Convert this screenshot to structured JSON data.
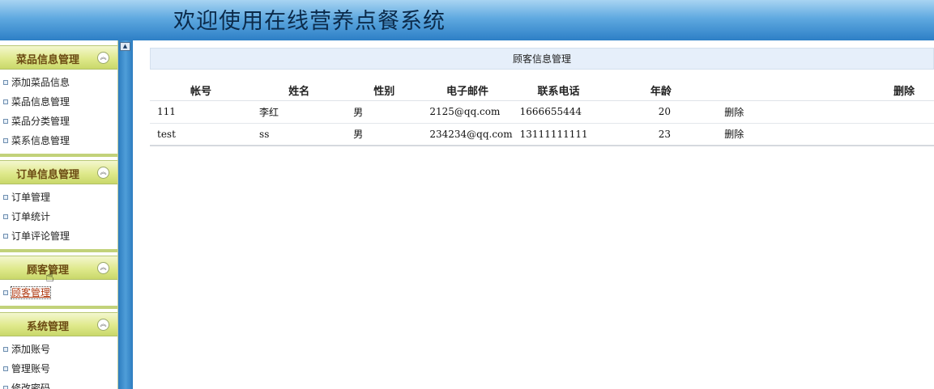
{
  "header": {
    "title": "欢迎使用在线营养点餐系统"
  },
  "sidebar": {
    "groups": [
      {
        "title": "菜品信息管理",
        "items": [
          "添加菜品信息",
          "菜品信息管理",
          "菜品分类管理",
          "菜系信息管理"
        ]
      },
      {
        "title": "订单信息管理",
        "items": [
          "订单管理",
          "订单统计",
          "订单评论管理"
        ]
      },
      {
        "title": "顾客管理",
        "items": [
          "顾客管理"
        ]
      },
      {
        "title": "系统管理",
        "items": [
          "添加账号",
          "管理账号",
          "修改密码"
        ]
      }
    ]
  },
  "main": {
    "panel_title": "顾客信息管理",
    "columns": [
      "帐号",
      "姓名",
      "性别",
      "电子邮件",
      "联系电话",
      "年龄",
      "删除"
    ],
    "rows": [
      {
        "account": "111",
        "name": "李红",
        "gender": "男",
        "email": "2125@qq.com",
        "phone": "1666655444",
        "age": "20",
        "action": "删除"
      },
      {
        "account": "test",
        "name": "ss",
        "gender": "男",
        "email": "234234@qq.com",
        "phone": "13111111111",
        "age": "23",
        "action": "删除"
      }
    ]
  }
}
